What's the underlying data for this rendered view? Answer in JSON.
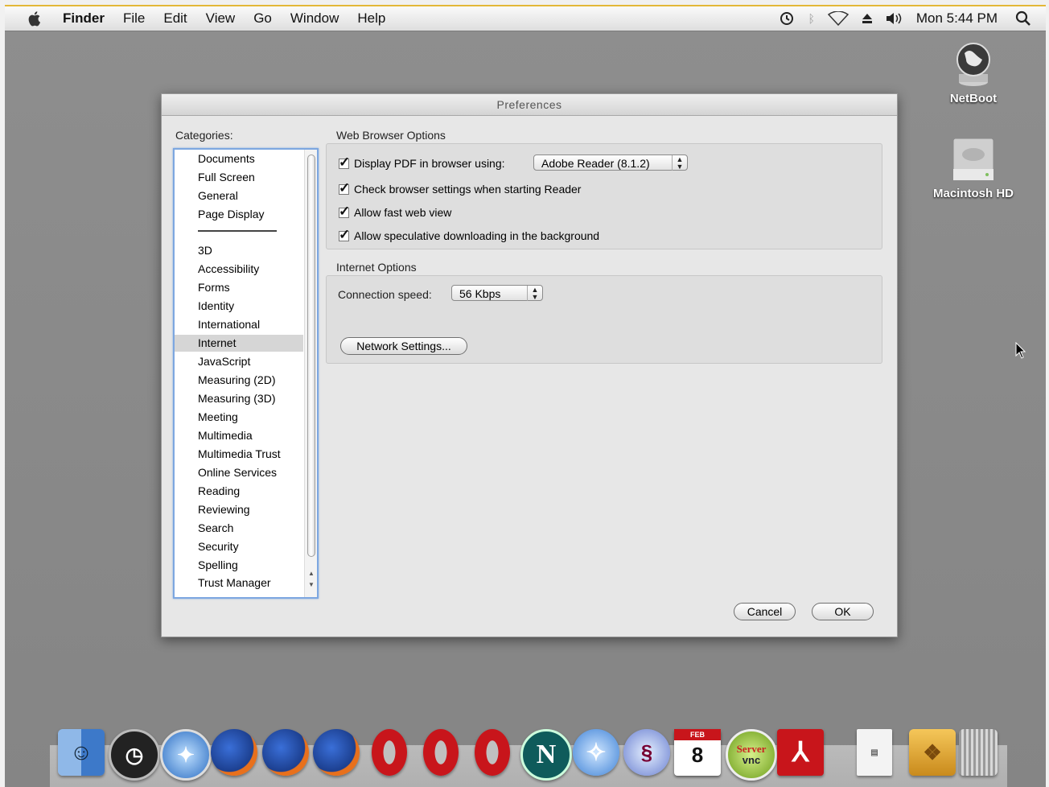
{
  "menubar": {
    "app": "Finder",
    "items": [
      "File",
      "Edit",
      "View",
      "Go",
      "Window",
      "Help"
    ],
    "clock": "Mon 5:44 PM",
    "status_icons": [
      "time-machine-icon",
      "bluetooth-icon",
      "wifi-icon",
      "eject-icon",
      "volume-icon",
      "spotlight-icon"
    ]
  },
  "desktop": {
    "icons": [
      {
        "label": "NetBoot",
        "icon": "netboot-globe-icon"
      },
      {
        "label": "Macintosh HD",
        "icon": "hard-drive-icon"
      }
    ]
  },
  "dialog": {
    "title": "Preferences",
    "categories_label": "Categories:",
    "categories_top": [
      "Documents",
      "Full Screen",
      "General",
      "Page Display"
    ],
    "categories": [
      "3D",
      "Accessibility",
      "Forms",
      "Identity",
      "International",
      "Internet",
      "JavaScript",
      "Measuring (2D)",
      "Measuring (3D)",
      "Meeting",
      "Multimedia",
      "Multimedia Trust",
      "Online Services",
      "Reading",
      "Reviewing",
      "Search",
      "Security",
      "Spelling",
      "Trust Manager"
    ],
    "selected_category": "Internet",
    "web_browser_options": {
      "heading": "Web Browser Options",
      "display_pdf_label": "Display PDF in browser using:",
      "display_pdf_checked": true,
      "browser_app": "Adobe Reader (8.1.2)",
      "check_settings_label": "Check browser settings when starting Reader",
      "check_settings_checked": true,
      "fast_web_view_label": "Allow fast web view",
      "fast_web_view_checked": true,
      "speculative_label": "Allow speculative downloading in the background",
      "speculative_checked": true
    },
    "internet_options": {
      "heading": "Internet Options",
      "connection_speed_label": "Connection speed:",
      "connection_speed": "56 Kbps",
      "network_settings": "Network Settings..."
    },
    "cancel": "Cancel",
    "ok": "OK"
  },
  "dock": {
    "items": [
      "finder-icon",
      "dashboard-icon",
      "safari-icon",
      "firefox-icon",
      "firefox-icon",
      "firefox-icon",
      "opera-icon",
      "opera-icon",
      "opera-icon",
      "netscape-icon",
      "camino-icon",
      "seamonkey-icon",
      "ical-icon",
      "server-vnc-icon",
      "adobe-reader-icon",
      "pdf-document-icon",
      "package-icon",
      "trash-icon"
    ],
    "ical_month": "FEB",
    "ical_day": "8",
    "vnc_text_top": "Server",
    "vnc_text_bottom": "vnc"
  },
  "colors": {
    "selection": "#d6d6d6",
    "list_focus": "#7da7e0",
    "menubar_accent": "#e3b838"
  }
}
